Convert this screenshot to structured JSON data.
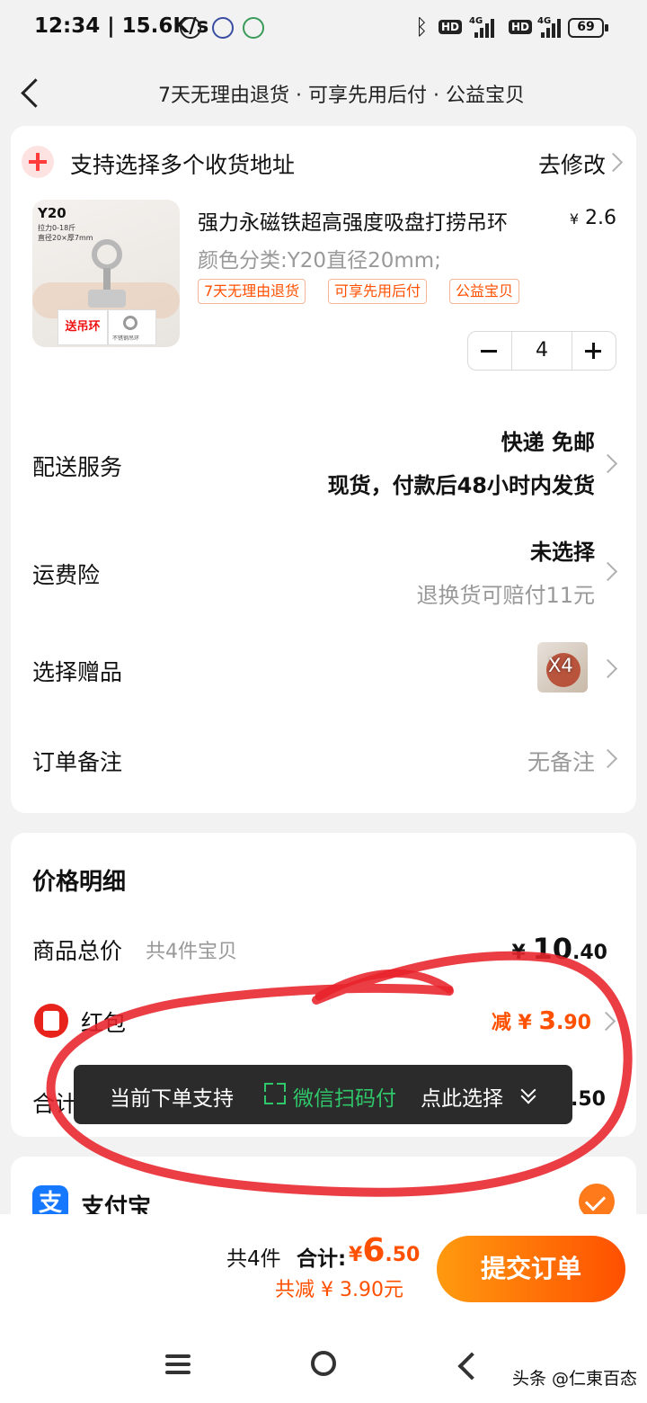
{
  "status_bar": {
    "time": "12:34",
    "speed": "15.6K/s",
    "hd1": "HD",
    "hd2": "HD",
    "net1": "4G",
    "net2": "4G",
    "battery": "69"
  },
  "header": {
    "title": "7天无理由退货 · 可享先用后付 · 公益宝贝"
  },
  "address": {
    "text": "支持选择多个收货地址",
    "edit": "去修改"
  },
  "product": {
    "image_text": {
      "model": "Y20",
      "spec1": "拉力0-18斤",
      "spec2": "直径20×厚7mm",
      "tag1": "送吊环",
      "tag2": "不锈钢吊环"
    },
    "title": "强力永磁铁超高强度吸盘打捞吊环",
    "price_symbol": "¥",
    "price": "2.6",
    "variant": "颜色分类:Y20直径20mm;",
    "tags": [
      "7天无理由退货",
      "可享先用后付",
      "公益宝贝"
    ],
    "quantity": "4"
  },
  "delivery": {
    "label": "配送服务",
    "line1": "快递 免邮",
    "line2": "现货，付款后48小时内发货"
  },
  "insurance": {
    "label": "运费险",
    "line1": "未选择",
    "line2": "退换货可赔付11元"
  },
  "gift": {
    "label": "选择赠品",
    "badge": "X4"
  },
  "note": {
    "label": "订单备注",
    "value": "无备注"
  },
  "price_detail": {
    "title": "价格明细",
    "goods_label": "商品总价",
    "goods_sub": "共4件宝贝",
    "goods_symbol": "¥",
    "goods_int": "10",
    "goods_dec": ".40",
    "redpack_label": "红包",
    "redpack_prefix": "减 ¥ ",
    "redpack_int": "3",
    "redpack_dec": ".90",
    "total_label": "合计",
    "total_dec": ".50"
  },
  "toast": {
    "pre": "当前下单支持",
    "wx": "微信扫码付",
    "pick": "点此选择"
  },
  "payment": {
    "icon": "支",
    "label": "支付宝"
  },
  "footer": {
    "count": "共4件",
    "total_label": "合计:",
    "symbol": "¥",
    "amount_int": "6",
    "amount_dec": ".50",
    "discount": "共减 ¥ 3.90元",
    "submit": "提交订单"
  },
  "watermark": "头条 @仁東百态",
  "colors": {
    "accent": "#ff5000",
    "wechat_green": "#2fc76a",
    "alipay_blue": "#1677ff",
    "annotation_red": "#e8222a"
  }
}
